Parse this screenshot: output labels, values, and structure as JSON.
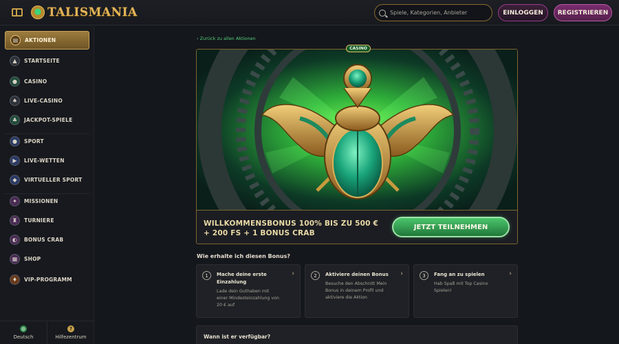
{
  "brand": {
    "name": "TALISMANIA"
  },
  "header": {
    "search_placeholder": "Spiele, Kategorien, Anbieter",
    "login_label": "EINLOGGEN",
    "register_label": "REGISTRIEREN"
  },
  "sidebar": {
    "items": [
      {
        "label": "AKTIONEN",
        "icon": "gift-icon",
        "active": true
      },
      {
        "label": "STARTSEITE",
        "icon": "pyramid-icon"
      },
      {
        "label": "CASINO",
        "icon": "casino-icon"
      },
      {
        "label": "LIVE-CASINO",
        "icon": "spade-icon"
      },
      {
        "label": "JACKPOT-SPIELE",
        "icon": "clover-icon"
      },
      {
        "label": "SPORT",
        "icon": "soccer-ball-icon"
      },
      {
        "label": "LIVE-WETTEN",
        "icon": "play-icon"
      },
      {
        "label": "VIRTUELLER SPORT",
        "icon": "gamepad-icon"
      },
      {
        "label": "MISSIONEN",
        "icon": "mission-icon"
      },
      {
        "label": "TURNIERE",
        "icon": "trophy-icon"
      },
      {
        "label": "BONUS CRAB",
        "icon": "crab-icon"
      },
      {
        "label": "SHOP",
        "icon": "shop-icon"
      },
      {
        "label": "VIP-PROGRAMM",
        "icon": "diamond-icon"
      }
    ],
    "footer": {
      "language": "Deutsch",
      "help": "Hilfezentrum"
    }
  },
  "main": {
    "back_link": "Zurück zu allen Aktionen",
    "badge": "CASINO",
    "offer_title_line1": "WILLKOMMENSBONUS 100% BIS ZU 500 €",
    "offer_title_line2": "+ 200 FS + 1 BONUS CRAB",
    "cta_label": "JETZT TEILNEHMEN",
    "how_title": "Wie erhalte ich diesen Bonus?",
    "steps": [
      {
        "num": "1",
        "title": "Mache deine erste Einzahlung",
        "desc": "Lade dein Guthaben mit einer Mindesteinzahlung von 20 € auf"
      },
      {
        "num": "2",
        "title": "Aktiviere deinen Bonus",
        "desc": "Besuche den Abschnitt Mein Bonus in deinem Profil und aktiviere die Aktion"
      },
      {
        "num": "3",
        "title": "Fang an zu spielen",
        "desc": "Hab Spaß mit Top Casino Spielen!"
      }
    ],
    "availability_title": "Wann ist er verfügbar?"
  },
  "colors": {
    "accent_gold": "#c9a24a",
    "accent_green": "#4bc56b",
    "register_purple": "#7a2c6d",
    "background": "#14171c"
  }
}
